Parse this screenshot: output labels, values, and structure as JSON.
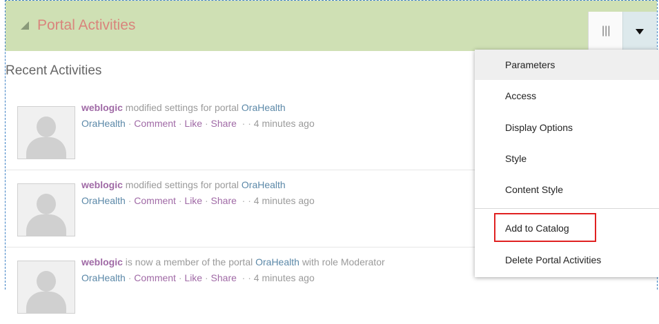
{
  "portlet": {
    "title": "Portal Activities",
    "layout_icon": "|||",
    "menu_icon": "chevron-down-icon"
  },
  "section_title": "Recent Activities",
  "activities": [
    {
      "user": "weblogic",
      "text_before": "modified settings for portal",
      "target": "OraHealth",
      "text_after": "",
      "source": "OraHealth",
      "comment": "Comment",
      "like": "Like",
      "share": "Share",
      "time": "4 minutes ago"
    },
    {
      "user": "weblogic",
      "text_before": "modified settings for portal",
      "target": "OraHealth",
      "text_after": "",
      "source": "OraHealth",
      "comment": "Comment",
      "like": "Like",
      "share": "Share",
      "time": "4 minutes ago"
    },
    {
      "user": "weblogic",
      "text_before": "is now a member of the portal",
      "target": "OraHealth",
      "text_after": "with role Moderator",
      "source": "OraHealth",
      "comment": "Comment",
      "like": "Like",
      "share": "Share",
      "time": "4 minutes ago"
    }
  ],
  "menu": {
    "items": [
      {
        "label": "Parameters"
      },
      {
        "label": "Access"
      },
      {
        "label": "Display Options"
      },
      {
        "label": "Style"
      },
      {
        "label": "Content Style"
      },
      {
        "label": "Add to Catalog"
      },
      {
        "label": "Delete Portal Activities"
      }
    ]
  },
  "colors": {
    "header_bg": "#cfe0b4",
    "title_color": "#d9847c",
    "highlight_border": "#e02020"
  }
}
